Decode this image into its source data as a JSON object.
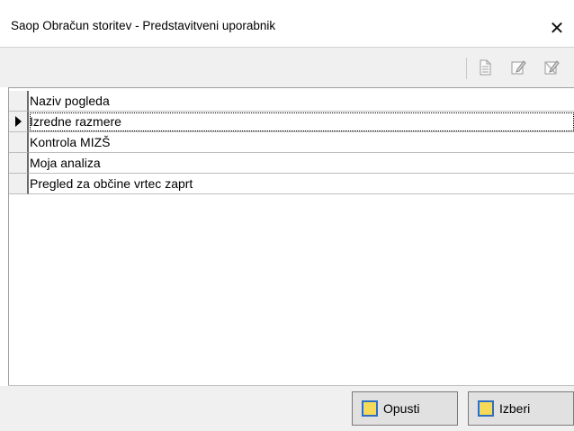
{
  "window": {
    "title": "Saop Obračun storitev - Predstavitveni uporabnik",
    "close_glyph": "✕"
  },
  "toolbar": {
    "icons": [
      "document-icon",
      "edit-icon",
      "edit-disabled-icon"
    ]
  },
  "grid": {
    "header": "Naziv pogleda",
    "rows": [
      {
        "label": "Izredne razmere",
        "selected": true
      },
      {
        "label": "Kontrola MIZŠ",
        "selected": false
      },
      {
        "label": "Moja analiza",
        "selected": false
      },
      {
        "label": "Pregled za občine vrtec zaprt",
        "selected": false
      }
    ]
  },
  "footer": {
    "cancel_label": "Opusti",
    "select_label": "Izberi"
  },
  "colors": {
    "button_icon_fill": "#f7d95a",
    "button_icon_border": "#2f6fbf",
    "toolbar_bg": "#f0f0f0"
  }
}
